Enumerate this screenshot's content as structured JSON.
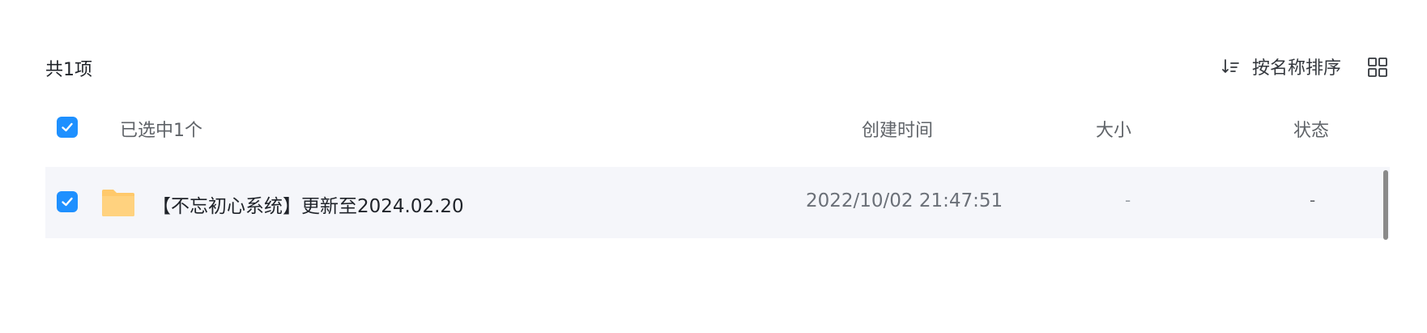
{
  "toolbar": {
    "count_label": "共1项",
    "sort_label": "按名称排序",
    "sort_icon": "sort-icon",
    "view_icon": "grid-view-icon"
  },
  "table": {
    "header": {
      "selected_label": "已选中1个",
      "created_label": "创建时间",
      "size_label": "大小",
      "status_label": "状态"
    },
    "rows": [
      {
        "name": "【不忘初心系统】更新至2024.02.20",
        "created": "2022/10/02 21:47:51",
        "size": "-",
        "status": "-",
        "checked": true,
        "icon": "folder-icon"
      }
    ]
  },
  "colors": {
    "accent": "#1e90ff",
    "row_bg": "#f5f6fa",
    "folder": "#ffc96b"
  }
}
